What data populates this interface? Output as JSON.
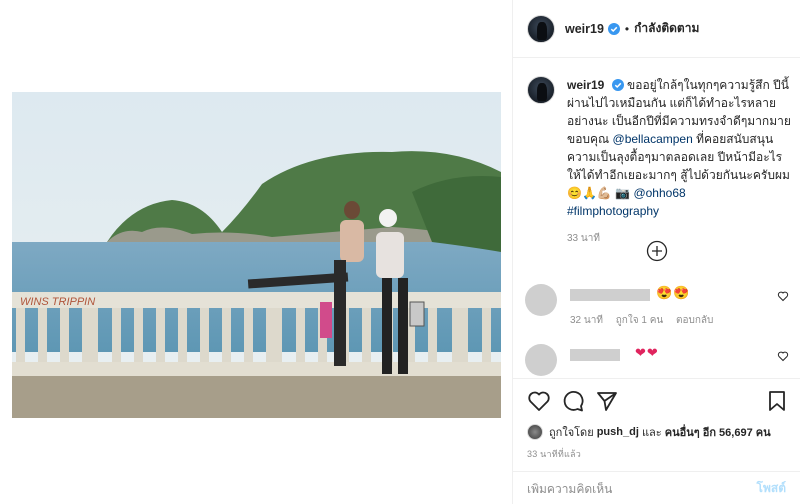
{
  "header": {
    "username": "weir19",
    "separator": "•",
    "follow_label": "กำลังติดตาม"
  },
  "caption": {
    "username": "weir19",
    "text_1": "ขออยู่ใกล้ๆในทุกๆความรู้สึก ปีนี้ผ่านไปไวเหมือนกัน แต่ก็ได้ทำอะไรหลายอย่างนะ เป็นอีกปีที่มีความทรงจำดีๆมากมาย ขอบคุณ ",
    "mention_1": "@bellacampen",
    "text_2": " ที่คอยสนับสนุนความเป็นลุงตื้อๆมาตลอดเลย ปีหน้ามีอะไรให้ได้ทำอีกเยอะมากๆ สู้ไปด้วยกันนะครับผม😊🙏💪🏼 📷 ",
    "mention_2": "@ohho68",
    "hashtag": "#filmphotography",
    "time": "33 นาที"
  },
  "comments": [
    {
      "emoji": "😍😍",
      "time": "32 นาที",
      "likes": "ถูกใจ 1 คน",
      "reply": "ตอบกลับ"
    },
    {
      "emoji": "❤❤"
    }
  ],
  "likes": {
    "prefix": "ถูกใจโดย",
    "user": "push_dj",
    "and": "และ",
    "others": "คนอื่นๆ อีก 56,697 คน"
  },
  "post_time": "33 นาทีที่แล้ว",
  "add_comment": {
    "placeholder": "เพิ่มความคิดเห็น",
    "post_label": "โพสต์"
  },
  "photo": {
    "graffiti": "WINS TRIPPIN"
  },
  "colors": {
    "link": "#003569",
    "verified": "#3897f0",
    "muted": "#8e8e8e",
    "post_disabled": "#b2dffc"
  }
}
